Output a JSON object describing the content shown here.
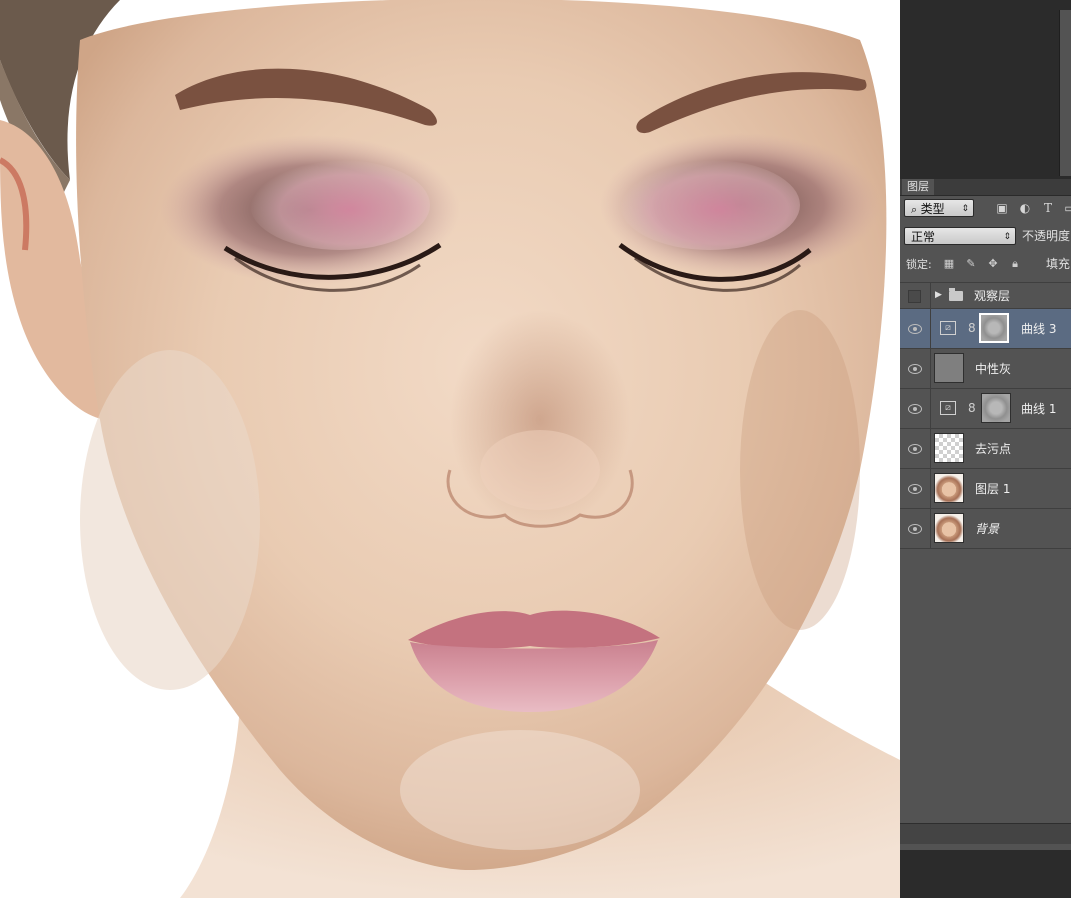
{
  "layers_panel": {
    "tab_label": "图层",
    "filter": {
      "kind_label": "类型",
      "icons": [
        "image-filter-icon",
        "adjustment-filter-icon",
        "type-filter-icon"
      ]
    },
    "blend_mode": "正常",
    "opacity_label": "不透明度",
    "lock_label": "锁定:",
    "fill_label": "填充",
    "layers": [
      {
        "name": "观察层",
        "kind": "group",
        "visible": false
      },
      {
        "name": "曲线 3",
        "kind": "curves",
        "visible": true,
        "active": true
      },
      {
        "name": "中性灰",
        "kind": "gray-fill",
        "visible": true
      },
      {
        "name": "曲线 1",
        "kind": "curves",
        "visible": true
      },
      {
        "name": "去污点",
        "kind": "transparent",
        "visible": true
      },
      {
        "name": "图层 1",
        "kind": "photo",
        "visible": true
      },
      {
        "name": "背景",
        "kind": "photo",
        "visible": true,
        "italic": true
      }
    ]
  },
  "colors": {
    "panel_bg": "#535353",
    "active_row": "#5b6b82",
    "workspace": "#2b2b2b",
    "canvas_bg": "#ffffff"
  }
}
